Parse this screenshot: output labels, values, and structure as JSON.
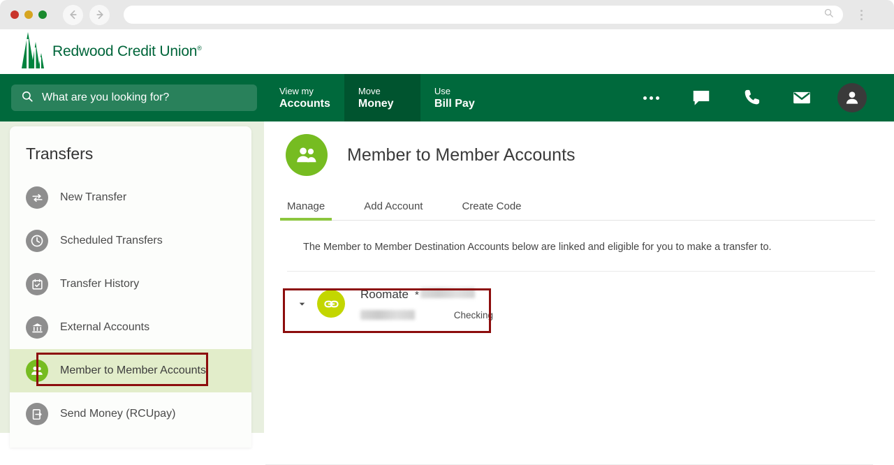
{
  "browser": {
    "traffic_lights": [
      "close",
      "minimize",
      "maximize"
    ],
    "back_icon": "arrow-left-icon",
    "forward_icon": "arrow-right-icon",
    "address_value": "",
    "address_search_icon": "search-icon",
    "menu_icon": "kebab-menu-icon"
  },
  "site_header": {
    "logo_text": "Redwood Credit Union",
    "logo_tm": "®",
    "logo_mark": "redwood-trees-logo",
    "brand_green": "#00653a"
  },
  "top_nav": {
    "search": {
      "placeholder": "What are you looking for?",
      "icon": "search-icon",
      "value": ""
    },
    "tabs": [
      {
        "top": "View my",
        "bottom": "Accounts",
        "active": false
      },
      {
        "top": "Move",
        "bottom": "Money",
        "active": true
      },
      {
        "top": "Use",
        "bottom": "Bill Pay",
        "active": false
      }
    ],
    "icons": [
      {
        "name": "ellipsis-icon",
        "label": "More"
      },
      {
        "name": "chat-icon",
        "label": "Chat"
      },
      {
        "name": "phone-icon",
        "label": "Call"
      },
      {
        "name": "envelope-icon",
        "label": "Messages"
      },
      {
        "name": "user-avatar-icon",
        "label": "Profile"
      }
    ],
    "bar_color": "#00693c",
    "active_tab_color": "#00542f"
  },
  "sidebar": {
    "title": "Transfers",
    "items": [
      {
        "label": "New Transfer",
        "icon": "transfer-arrows-icon",
        "selected": false
      },
      {
        "label": "Scheduled Transfers",
        "icon": "clock-icon",
        "selected": false
      },
      {
        "label": "Transfer History",
        "icon": "calendar-check-icon",
        "selected": false
      },
      {
        "label": "External Accounts",
        "icon": "bank-icon",
        "selected": false
      },
      {
        "label": "Member to Member Accounts",
        "icon": "two-people-icon",
        "selected": true
      },
      {
        "label": "Send Money (RCUpay)",
        "icon": "send-money-icon",
        "selected": false
      }
    ],
    "selected_bg": "#e2edca",
    "selected_icon_color": "#76bc21"
  },
  "main": {
    "page_title": "Member to Member Accounts",
    "page_title_icon": "two-people-icon",
    "tabs": [
      {
        "label": "Manage",
        "active": true
      },
      {
        "label": "Add Account",
        "active": false
      },
      {
        "label": "Create Code",
        "active": false
      }
    ],
    "active_tab_underline": "#8cc63e",
    "description": "The Member to Member Destination Accounts below are linked and eligible for you to make a transfer to.",
    "accounts": [
      {
        "name": "Roomate",
        "masked_prefix": "*",
        "masked_number": "",
        "secondary_masked": "",
        "type": "Checking",
        "icon": "link-chain-icon",
        "icon_color": "#c3d600",
        "expand_icon": "chevron-down-icon"
      }
    ]
  },
  "annotations": {
    "highlight_color": "#8c0d0d",
    "boxes": [
      {
        "target": "sidebar-item-member-to-member-accounts"
      },
      {
        "target": "account-row-roomate"
      }
    ]
  }
}
